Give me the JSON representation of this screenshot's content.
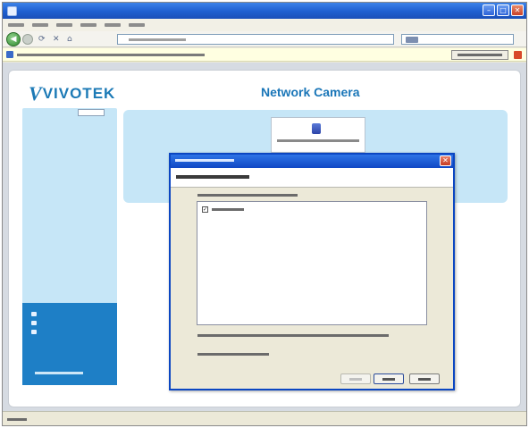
{
  "window": {
    "title": "",
    "controls": [
      "minimize-icon",
      "maximize-icon",
      "close-icon"
    ]
  },
  "menu": {
    "items": [
      "",
      "",
      "",
      "",
      "",
      ""
    ]
  },
  "toolbar": {
    "back_icon": "back-icon",
    "forward_icon": "forward-icon",
    "address": "",
    "search_placeholder": ""
  },
  "infobar": {
    "text": "",
    "button_label": ""
  },
  "page": {
    "logo_text": "VIVOTEK",
    "title": "Network Camera",
    "sidebar": {
      "video_stream_label": "",
      "video_stream_value": "",
      "manual_trigger_label": "",
      "links": [
        {
          "label": "",
          "icon": "settings-icon"
        },
        {
          "label": "",
          "icon": "configuration-icon"
        },
        {
          "label": "",
          "icon": "language-icon"
        }
      ],
      "powered_by": ""
    },
    "plugin_notice": ""
  },
  "dialog": {
    "title": "",
    "header": "",
    "list_label": "",
    "items": [
      {
        "label": "",
        "checked": true
      }
    ],
    "note_1": "",
    "note_2": "",
    "buttons": {
      "back": "",
      "next": "",
      "cancel": ""
    }
  },
  "status": {
    "text": ""
  },
  "colors": {
    "accent": "#1c7ab6",
    "sidebar": "#c6e6f7",
    "sidebar_bottom": "#1e7fc6",
    "dialog_title": "#1047c4"
  }
}
